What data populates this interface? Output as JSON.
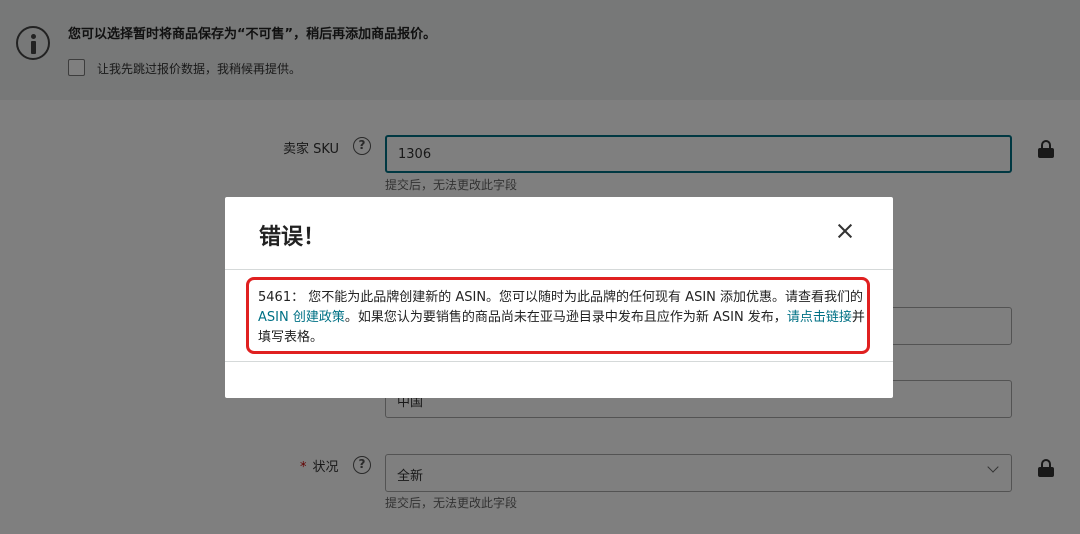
{
  "banner": {
    "title": "您可以选择暂时将商品保存为“不可售”，稍后再添加商品报价。",
    "checkbox_label": "让我先跳过报价数据，我稍候再提供。"
  },
  "form": {
    "sku": {
      "label": "卖家 SKU",
      "value": "1306",
      "hint": "提交后，无法更改此字段"
    },
    "country": {
      "value": "中国"
    },
    "condition": {
      "required_mark": "*",
      "label": "状况",
      "value": "全新",
      "hint": "提交后，无法更改此字段"
    },
    "help_glyph": "?"
  },
  "modal": {
    "title": "错误！",
    "message": {
      "part1": "5461： 您不能为此品牌创建新的 ASIN。您可以随时为此品牌的任何现有 ASIN 添加优惠。请查看我们的 ",
      "link1": "ASIN 创建政策",
      "part2": "。如果您认为要销售的商品尚未在亚马逊目录中发布且应作为新 ASIN 发布，",
      "link2": "请点击链接",
      "part3": "并填写表格。"
    }
  },
  "colors": {
    "link": "#007185",
    "highlight": "#e02020",
    "overlay": "rgba(0,0,0,0.5)"
  },
  "icons": [
    "info-icon",
    "help-icon",
    "lock-icon",
    "close-icon",
    "chevron-down-icon"
  ]
}
